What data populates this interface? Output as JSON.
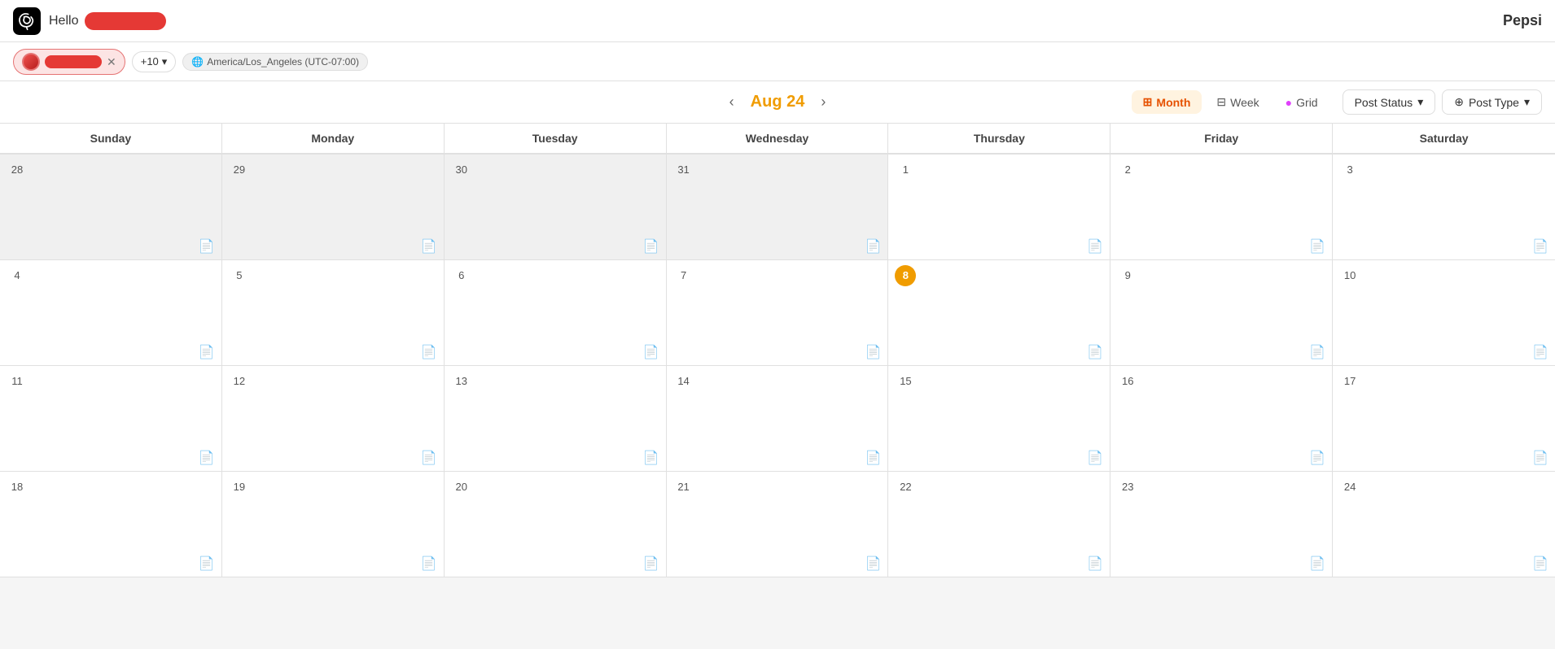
{
  "app": {
    "logo_alt": "Threads logo",
    "hello_text": "Hello",
    "brand_name": "Pepsi"
  },
  "filterbar": {
    "filter_chip_count": "+10",
    "timezone": "America/Los_Angeles (UTC-07:00)"
  },
  "calendar": {
    "title": "Aug 24",
    "view_month": "Month",
    "view_week": "Week",
    "view_grid": "Grid",
    "filter_post_status": "Post Status",
    "filter_post_type": "Post Type",
    "days_of_week": [
      "Sunday",
      "Monday",
      "Tuesday",
      "Wednesday",
      "Thursday",
      "Friday",
      "Saturday"
    ],
    "weeks": [
      [
        {
          "day": "28",
          "type": "other"
        },
        {
          "day": "29",
          "type": "other"
        },
        {
          "day": "30",
          "type": "other"
        },
        {
          "day": "31",
          "type": "other"
        },
        {
          "day": "1",
          "type": "current"
        },
        {
          "day": "2",
          "type": "current"
        },
        {
          "day": "3",
          "type": "current"
        }
      ],
      [
        {
          "day": "4",
          "type": "current"
        },
        {
          "day": "5",
          "type": "current"
        },
        {
          "day": "6",
          "type": "current"
        },
        {
          "day": "7",
          "type": "current"
        },
        {
          "day": "8",
          "type": "today"
        },
        {
          "day": "9",
          "type": "current"
        },
        {
          "day": "10",
          "type": "current"
        }
      ],
      [
        {
          "day": "11",
          "type": "current"
        },
        {
          "day": "12",
          "type": "current"
        },
        {
          "day": "13",
          "type": "current"
        },
        {
          "day": "14",
          "type": "current"
        },
        {
          "day": "15",
          "type": "current"
        },
        {
          "day": "16",
          "type": "current"
        },
        {
          "day": "17",
          "type": "current"
        }
      ],
      [
        {
          "day": "18",
          "type": "current"
        },
        {
          "day": "19",
          "type": "current"
        },
        {
          "day": "20",
          "type": "current"
        },
        {
          "day": "21",
          "type": "current"
        },
        {
          "day": "22",
          "type": "current"
        },
        {
          "day": "23",
          "type": "current"
        },
        {
          "day": "24",
          "type": "current"
        }
      ]
    ]
  }
}
